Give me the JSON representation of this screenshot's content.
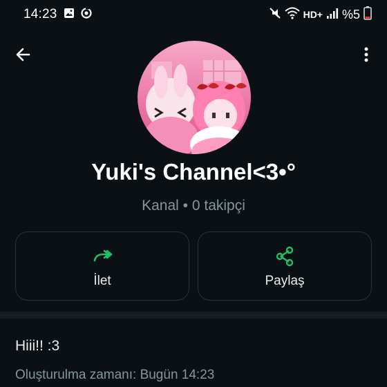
{
  "status_bar": {
    "time": "14:23",
    "network_label": "HD+",
    "battery_label": "%5",
    "icons": [
      "gallery-icon",
      "sync-icon",
      "mute-icon",
      "wifi-icon",
      "signal-icon",
      "battery-icon"
    ]
  },
  "header": {
    "back_icon": "arrow-left-icon",
    "menu_icon": "more-vert-icon"
  },
  "channel": {
    "name": "Yuki's Channel<3•°",
    "subtitle": "Kanal • 0 takipçi"
  },
  "actions": [
    {
      "label": "İlet",
      "icon": "forward-icon"
    },
    {
      "label": "Paylaş",
      "icon": "share-icon"
    }
  ],
  "info": {
    "description": "Hiii!! :3",
    "created": "Oluşturulma zamanı: Bugün 14:23"
  },
  "colors": {
    "background": "#0b1014",
    "accent_green": "#21c063",
    "muted_text": "#8696a0",
    "battery_low": "#e53935"
  }
}
